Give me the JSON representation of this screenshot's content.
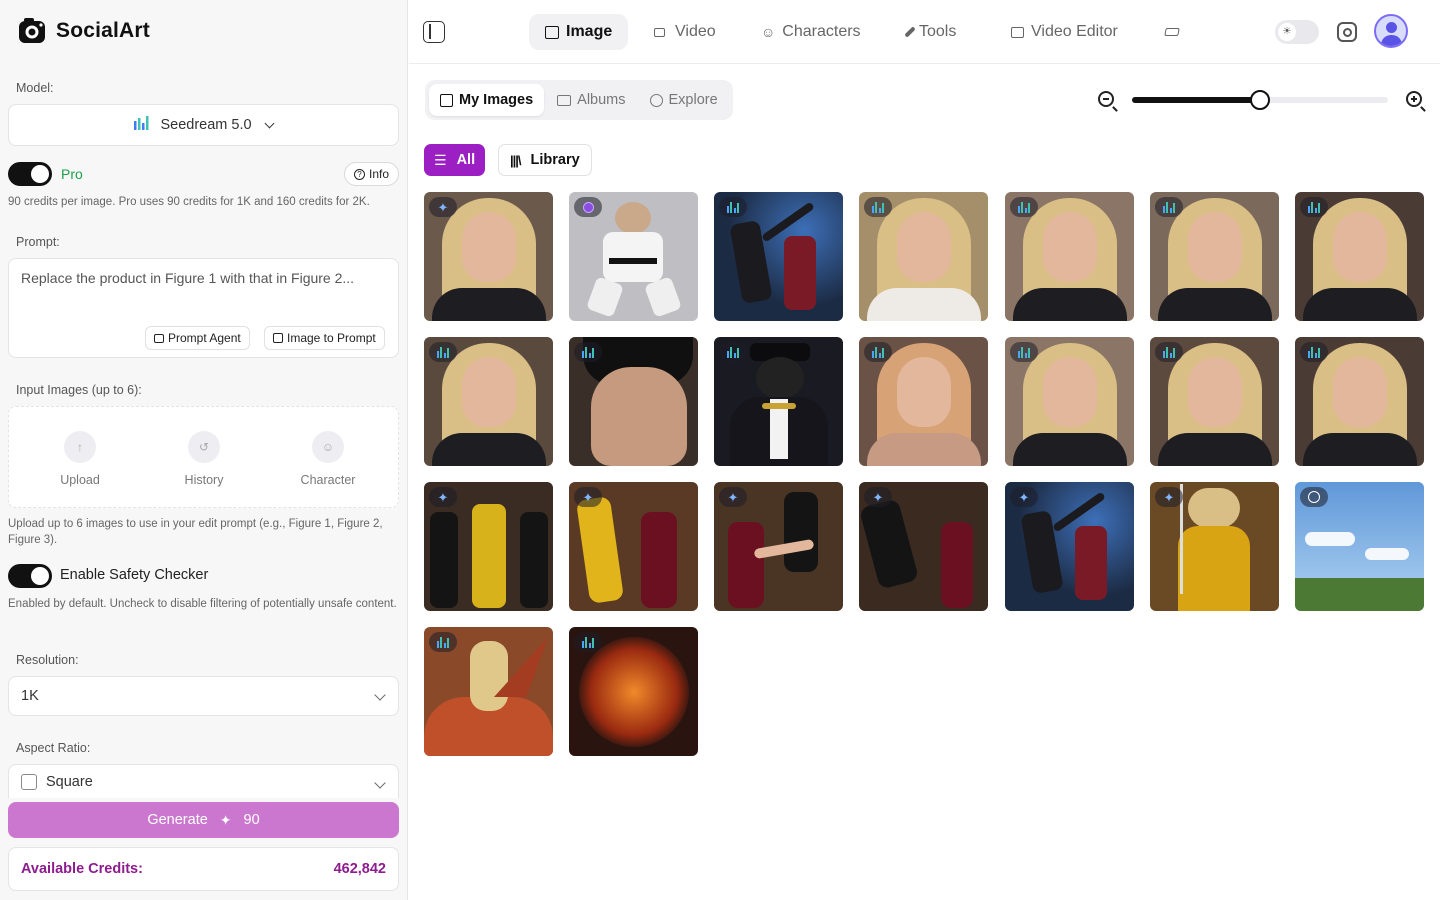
{
  "brand": {
    "name": "SocialArt"
  },
  "sidebar": {
    "model_label": "Model:",
    "model_value": "Seedream 5.0",
    "pro_label": "Pro",
    "info_label": "Info",
    "pro_hint": "90 credits per image. Pro uses 90 credits for 1K and 160 credits for 2K.",
    "prompt_label": "Prompt:",
    "prompt_value": "Replace the product in Figure 1 with that in Figure 2...",
    "prompt_agent_label": "Prompt Agent",
    "image_to_prompt_label": "Image to Prompt",
    "input_images_label": "Input Images (up to 6):",
    "slots": [
      {
        "label": "Upload",
        "icon": "upload-icon"
      },
      {
        "label": "History",
        "icon": "history-icon"
      },
      {
        "label": "Character",
        "icon": "user-icon"
      }
    ],
    "input_hint": "Upload up to 6 images to use in your edit prompt (e.g., Figure 1, Figure 2, Figure 3).",
    "safety_label": "Enable Safety Checker",
    "safety_hint": "Enabled by default. Uncheck to disable filtering of potentially unsafe content.",
    "resolution_label": "Resolution:",
    "resolution_value": "1K",
    "aspect_label": "Aspect Ratio:",
    "aspect_value": "Square",
    "generate_label": "Generate",
    "generate_cost": "90",
    "credits_label": "Available Credits:",
    "credits_value": "462,842"
  },
  "nav": {
    "items": [
      {
        "label": "Image",
        "icon": "image-icon",
        "active": true
      },
      {
        "label": "Video",
        "icon": "video-icon",
        "active": false
      },
      {
        "label": "Characters",
        "icon": "user-icon",
        "active": false
      },
      {
        "label": "Tools",
        "icon": "wrench-icon",
        "active": false
      },
      {
        "label": "Video Editor",
        "icon": "clapper-icon",
        "active": false
      },
      {
        "label": "",
        "icon": "graduation-cap-icon",
        "active": false
      }
    ]
  },
  "gallery": {
    "tabs": [
      {
        "label": "My Images",
        "icon": "image-icon",
        "active": true
      },
      {
        "label": "Albums",
        "icon": "folder-icon",
        "active": false
      },
      {
        "label": "Explore",
        "icon": "compass-icon",
        "active": false
      }
    ],
    "zoom_level": 0.5,
    "filters": {
      "all": "All",
      "library": "Library"
    },
    "images": [
      {
        "badge": "gemini",
        "subject": "blonde-portrait",
        "bg": "#6b5a4c"
      },
      {
        "badge": "purple",
        "subject": "karate-cat",
        "bg": "#bfbfc3"
      },
      {
        "badge": "seedream",
        "subject": "fight-scene",
        "bg": "#1c2b44"
      },
      {
        "badge": "seedream",
        "subject": "blonde-outdoor",
        "bg": "#a48f6a"
      },
      {
        "badge": "seedream",
        "subject": "blonde-portrait",
        "bg": "#8a7566"
      },
      {
        "badge": "seedream",
        "subject": "blonde-portrait",
        "bg": "#7b6a5c"
      },
      {
        "badge": "seedream",
        "subject": "blonde-portrait",
        "bg": "#4a3c34"
      },
      {
        "badge": "seedream",
        "subject": "blonde-portrait",
        "bg": "#5a4a3e"
      },
      {
        "badge": "seedream",
        "subject": "man-closeup",
        "bg": "#3a2e28"
      },
      {
        "badge": "seedream",
        "subject": "cat-mobster",
        "bg": "#1a1a22"
      },
      {
        "badge": "seedream",
        "subject": "redhead-portrait",
        "bg": "#6a5346"
      },
      {
        "badge": "seedream",
        "subject": "blonde-portrait",
        "bg": "#8a7566"
      },
      {
        "badge": "seedream",
        "subject": "blonde-portrait",
        "bg": "#5c4a3e"
      },
      {
        "badge": "seedream",
        "subject": "blonde-portrait",
        "bg": "#4a3c34"
      },
      {
        "badge": "gemini",
        "subject": "yellow-suit-trio",
        "bg": "#3a2c22"
      },
      {
        "badge": "gemini",
        "subject": "yellow-suit-fight",
        "bg": "#5a3a24"
      },
      {
        "badge": "gemini",
        "subject": "red-dress-fight",
        "bg": "#4a3424"
      },
      {
        "badge": "gemini",
        "subject": "blonde-kick",
        "bg": "#3a2a20"
      },
      {
        "badge": "gemini",
        "subject": "fight-scene",
        "bg": "#1c2b44"
      },
      {
        "badge": "gemini",
        "subject": "yellow-suit-sword",
        "bg": "#6a4a24"
      },
      {
        "badge": "openai",
        "subject": "sky-field",
        "bg": "#6fa7de"
      },
      {
        "badge": "seedream",
        "subject": "dragon-rider",
        "bg": "#8a4a2a"
      },
      {
        "badge": "seedream",
        "subject": "fire-dragon",
        "bg": "#2a1410"
      }
    ]
  },
  "colors": {
    "accent": "#9b1fc2",
    "generate": "#cc77cf",
    "credits_text": "#8d1c8e",
    "pro_green": "#1aa34a"
  }
}
